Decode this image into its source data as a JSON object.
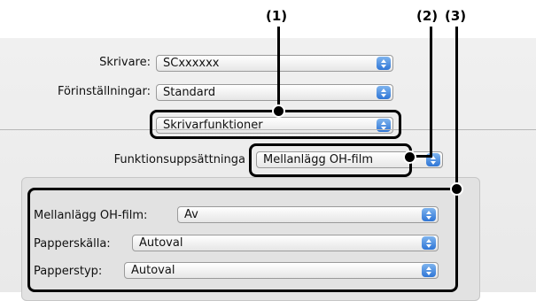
{
  "callouts": [
    "(1)",
    "(2)",
    "(3)"
  ],
  "printer": {
    "label": "Skrivare:",
    "value": "SCxxxxxx"
  },
  "presets": {
    "label": "Förinställningar:",
    "value": "Standard"
  },
  "panel": {
    "value": "Skrivarfunktioner"
  },
  "featureset": {
    "label": "Funktionsuppsättninga",
    "value": "Mellanlägg OH-film"
  },
  "options": [
    {
      "label": "Mellanlägg OH-film:",
      "value": "Av"
    },
    {
      "label": "Papperskälla:",
      "value": "Autoval"
    },
    {
      "label": "Papperstyp:",
      "value": "Autoval"
    }
  ],
  "colors": {
    "popup_arrows": "#3b82dc",
    "callout": "#000000"
  }
}
